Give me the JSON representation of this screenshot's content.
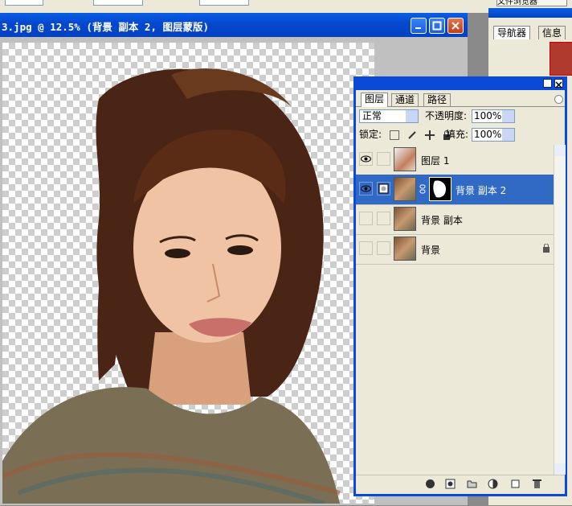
{
  "document": {
    "title": "3.jpg @ 12.5% (背景 副本 2, 图层蒙版)"
  },
  "navigator": {
    "top_button": "文件浏览器",
    "tabs": [
      "导航器",
      "信息"
    ]
  },
  "layers_panel": {
    "tabs": [
      "图层",
      "通道",
      "路径"
    ],
    "blend_mode": "正常",
    "opacity_label": "不透明度:",
    "opacity_value": "100%",
    "lock_label": "锁定:",
    "fill_label": "填充:",
    "fill_value": "100%",
    "layers": [
      {
        "name": "图层 1",
        "visible": true,
        "selected": false
      },
      {
        "name": "背景 副本 2",
        "visible": true,
        "selected": true,
        "has_mask": true
      },
      {
        "name": "背景 副本",
        "visible": false,
        "selected": false
      },
      {
        "name": "背景",
        "visible": false,
        "selected": false,
        "locked": true
      }
    ]
  },
  "colors": {
    "titlebar": "#0547cf",
    "selection": "#316ac5",
    "panel_bg": "#ece9d8"
  }
}
